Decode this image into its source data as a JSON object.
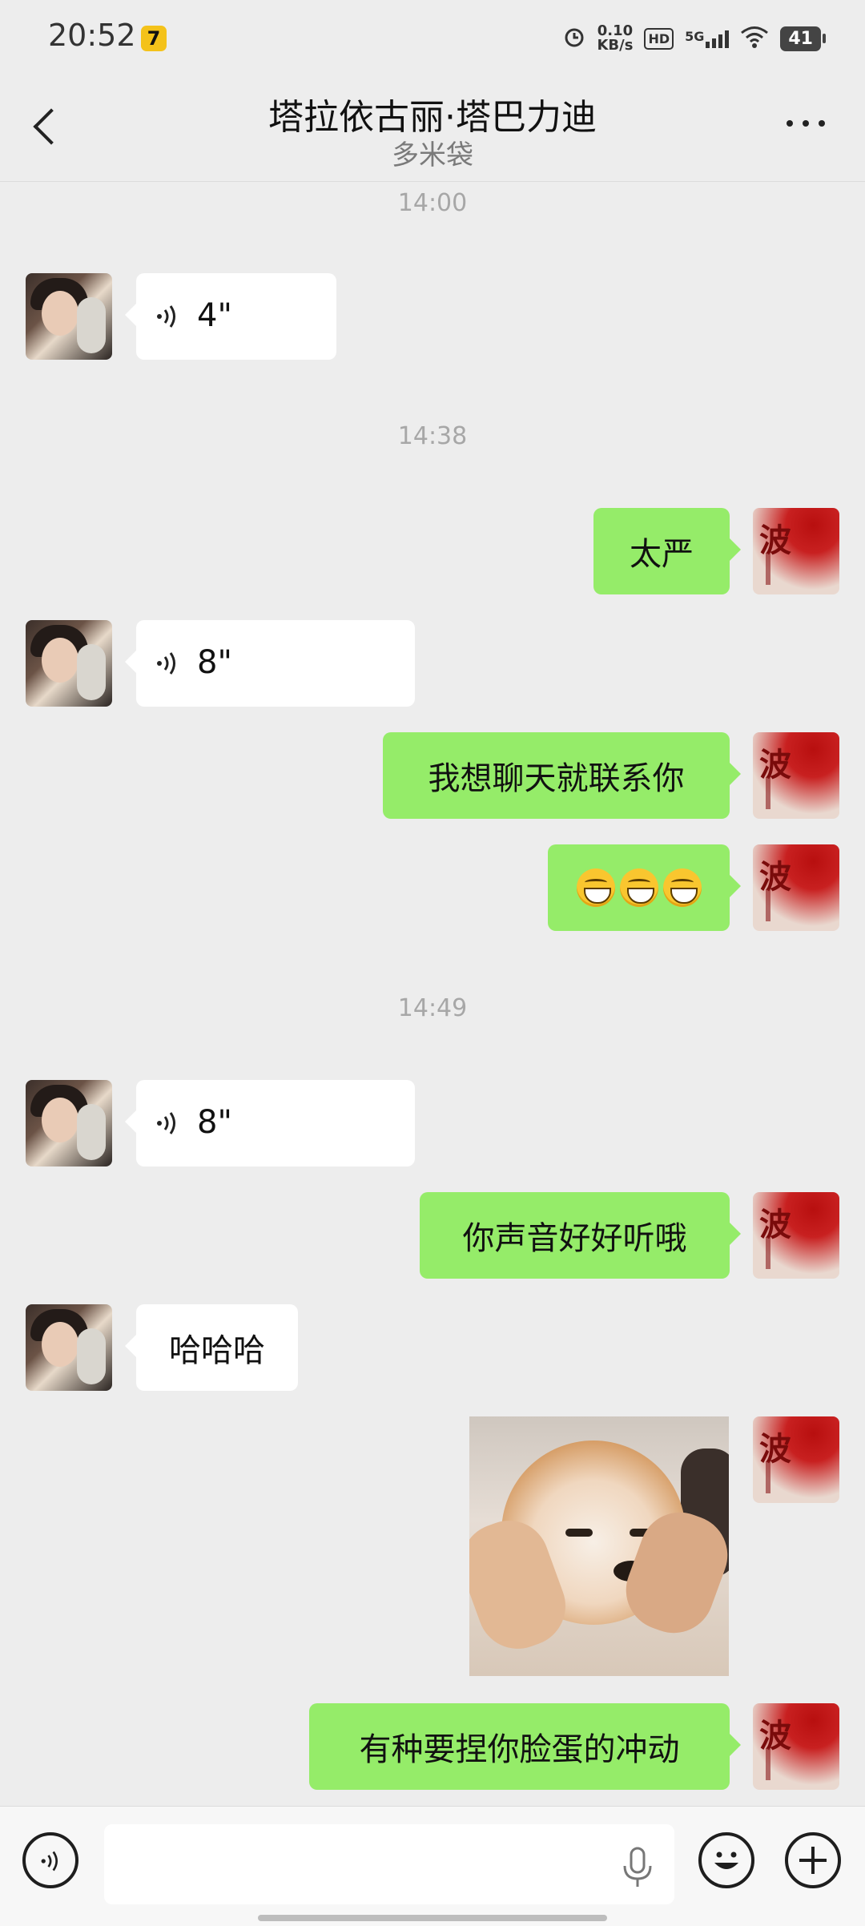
{
  "status_bar": {
    "time": "20:52",
    "network_speed_value": "0.10",
    "network_speed_unit": "KB/s",
    "hd_badge": "HD",
    "network_type": "5G",
    "battery": "41",
    "icons": [
      "app-notification-icon",
      "alarm-icon",
      "signal-icon",
      "wifi-icon",
      "battery-icon"
    ]
  },
  "header": {
    "title": "塔拉依古丽·塔巴力迪",
    "subtitle": "多米袋",
    "icons": [
      "back-arrow-icon",
      "more-options-icon"
    ]
  },
  "chat": {
    "timestamps": [
      "14:00",
      "14:38",
      "14:49"
    ],
    "messages": [
      {
        "type": "voice",
        "direction": "incoming",
        "duration": "4\""
      },
      {
        "type": "text",
        "direction": "outgoing",
        "text": "太严"
      },
      {
        "type": "voice",
        "direction": "incoming",
        "duration": "8\""
      },
      {
        "type": "text",
        "direction": "outgoing",
        "text": "我想聊天就联系你"
      },
      {
        "type": "emoji",
        "direction": "outgoing",
        "emoji": "grinning-face",
        "count": 3
      },
      {
        "type": "voice",
        "direction": "incoming",
        "duration": "8\""
      },
      {
        "type": "text",
        "direction": "outgoing",
        "text": "你声音好好听哦"
      },
      {
        "type": "text",
        "direction": "incoming",
        "text": "哈哈哈"
      },
      {
        "type": "image",
        "direction": "outgoing",
        "subject": "shiba-dog-face-being-squeezed"
      },
      {
        "type": "text",
        "direction": "outgoing",
        "text": "有种要捏你脸蛋的冲动"
      }
    ]
  },
  "input_bar": {
    "value": "",
    "placeholder": "",
    "icons": [
      "voice-toggle-icon",
      "microphone-icon",
      "emoji-icon",
      "plus-icon"
    ]
  },
  "colors": {
    "background": "#EDEDED",
    "outgoing_bubble": "#95EC69",
    "incoming_bubble": "#FFFFFF",
    "timestamp_text": "#A7A7A7",
    "subtitle_text": "#7A7A7A"
  }
}
